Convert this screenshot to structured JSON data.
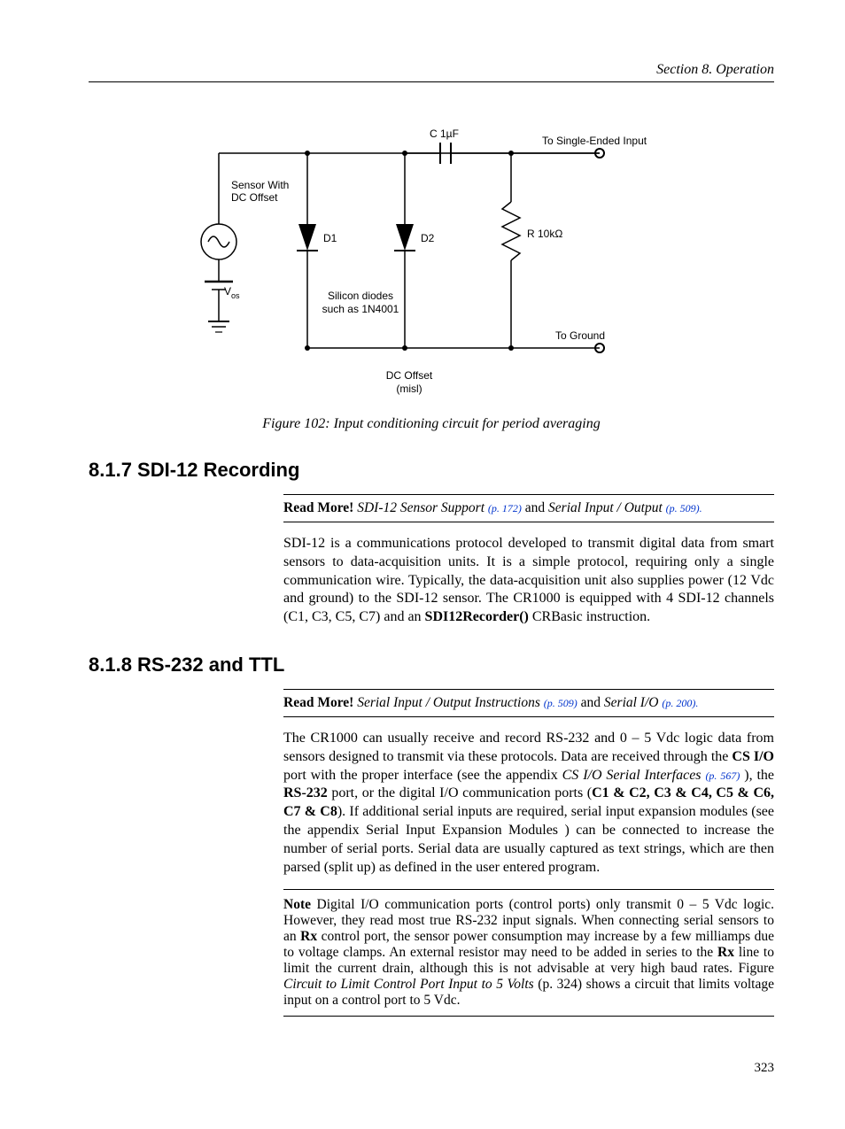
{
  "header": {
    "running_title": "Section 8.  Operation"
  },
  "figure": {
    "caption": "Figure 102: Input conditioning circuit for period averaging",
    "labels": {
      "sensor_line1": "Sensor With",
      "sensor_line2": "DC Offset",
      "vos": "V",
      "vos_sub": "os",
      "d1": "D1",
      "d2": "D2",
      "diode_line1": "Silicon diodes",
      "diode_line2": "such as 1N4001",
      "c": "C 1µF",
      "r": "R 10kΩ",
      "to_se": "To Single-Ended Input",
      "to_gnd": "To Ground",
      "dcoff_line1": "DC Offset",
      "dcoff_line2": "(misl)"
    }
  },
  "sec817": {
    "title": "8.1.7 SDI-12 Recording",
    "readmore_label": "Read More!",
    "rm_ital1": "SDI-12 Sensor Support",
    "rm_link1": "(p. 172)",
    "rm_mid": " and ",
    "rm_ital2": "Serial Input / Output",
    "rm_link2": "(p. 509).",
    "para1a": "SDI-12 is a communications protocol developed to transmit digital data from smart sensors to data-acquisition units. It is a simple protocol, requiring only a single communication wire. Typically, the data-acquisition unit also supplies power (12 Vdc and ground) to the SDI-12 sensor. The CR1000 is equipped with 4 SDI-12 channels (C1, C3, C5, C7) and an ",
    "para1b_bold": "SDI12Recorder()",
    "para1c": " CRBasic instruction."
  },
  "sec818": {
    "title": "8.1.8 RS-232 and TTL",
    "readmore_label": "Read More!",
    "rm_ital1": "Serial Input / Output Instructions",
    "rm_link1": "(p. 509)",
    "rm_mid": " and ",
    "rm_ital2": "Serial I/O",
    "rm_link2": "(p. 200).",
    "p1_a": "The CR1000 can usually receive and record RS-232 and 0 – 5 Vdc logic data from sensors designed to transmit via these protocols. Data are received through the ",
    "p1_b_bold": "CS I/O",
    "p1_c": " port with the proper interface (see the appendix ",
    "p1_d_ital": "CS I/O Serial Interfaces",
    "p1_e_link": "(p. 567)",
    "p1_f": " ), the ",
    "p1_g_bold": "RS-232",
    "p1_h": " port, or the digital I/O communication ports (",
    "p1_i_bold": "C1 & C2, C3 & C4, C5 & C6, C7 & C8",
    "p1_j": "). If additional serial inputs are required, serial input expansion modules (see the appendix Serial Input Expansion Modules ) can be connected to increase the number of serial ports. Serial data are usually captured as text strings, which are then parsed (split up) as defined in the user entered program.",
    "note_label": "Note",
    "note_a": "  Digital I/O communication ports (control ports) only transmit 0 – 5 Vdc logic. However, they read most true RS-232 input signals. When connecting serial sensors to an ",
    "note_b_bold": "Rx",
    "note_c": " control port, the sensor power consumption may increase by a few milliamps due to voltage clamps. An external resistor may need to be added in series to the ",
    "note_d_bold": "Rx",
    "note_e": " line to limit the current drain, although this is not advisable at very high baud rates.  Figure ",
    "note_f_ital": "Circuit to Limit Control Port Input to 5 Volts",
    "note_g": " (p. 324) shows a circuit that limits voltage input on a control port to 5 Vdc."
  },
  "page_number": "323"
}
